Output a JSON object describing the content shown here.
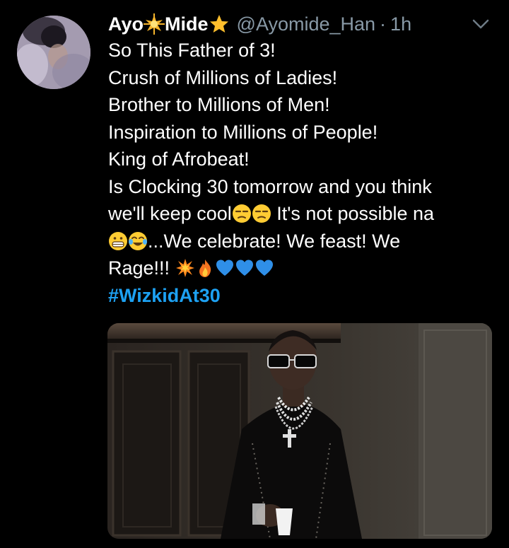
{
  "tweet": {
    "author": {
      "name_part1": "Ayo",
      "name_part2": "Mide",
      "name_emoji_1": "glowing-star-emoji",
      "name_emoji_2": "star-emoji",
      "handle": "@Ayomide_Han",
      "separator": "·",
      "time": "1h"
    },
    "body": {
      "line1": "So This Father of 3!",
      "line2": "Crush of Millions of Ladies!",
      "line3": "Brother to Millions of Men!",
      "line4": "Inspiration to Millions of People!",
      "line5": "King of Afrobeat!",
      "line6": "Is Clocking 30 tomorrow and you think",
      "line7a": "we'll keep cool",
      "line7b": " It's not possible na",
      "line8": "...We celebrate! We feast! We",
      "line9": "Rage!!! ",
      "hashtag": "#WizkidAt30"
    },
    "emojis": [
      "unamused-face",
      "unamused-face",
      "grinning-face",
      "face-with-tears-of-joy",
      "collision",
      "fire",
      "blue-heart",
      "blue-heart",
      "blue-heart"
    ],
    "media": {
      "description_icon": "photo-image"
    }
  },
  "colors": {
    "background": "#000000",
    "text": "#ffffff",
    "secondary_text": "#8899a6",
    "link": "#1da1f2"
  }
}
